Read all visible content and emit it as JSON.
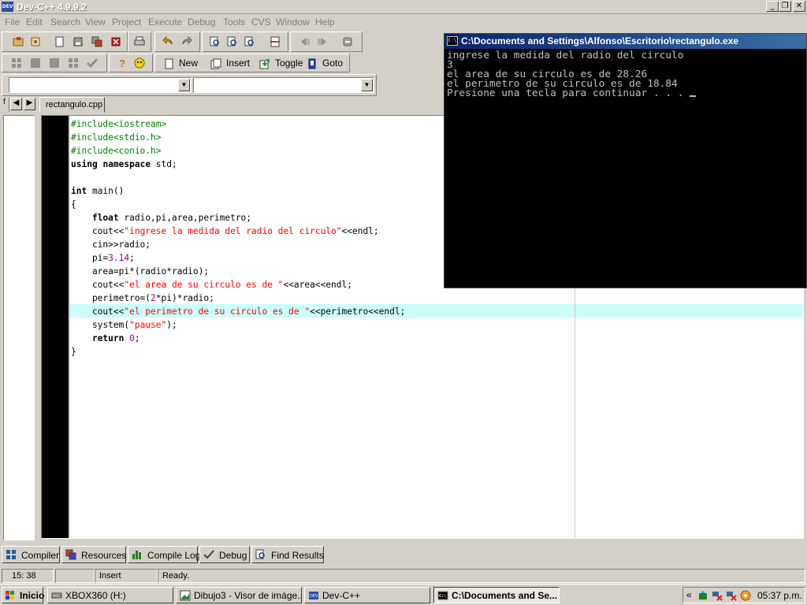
{
  "window": {
    "title": "Dev-C++ 4.9.9.2",
    "icon_label": "DEV"
  },
  "menu": [
    "File",
    "Edit",
    "Search",
    "View",
    "Project",
    "Execute",
    "Debug",
    "Tools",
    "CVS",
    "Window",
    "Help"
  ],
  "toolbar": {
    "new": "New",
    "insert": "Insert",
    "toggle": "Toggle",
    "goto": "Goto"
  },
  "editor": {
    "tab": "rectangulo.cpp",
    "lines": [
      [
        [
          "pp",
          "#include<iostream>"
        ]
      ],
      [
        [
          "pp",
          "#include<stdio.h>"
        ]
      ],
      [
        [
          "pp",
          "#include<conio.h>"
        ]
      ],
      [
        [
          "kw",
          "using"
        ],
        [
          "",
          " "
        ],
        [
          "kw",
          "namespace"
        ],
        [
          "",
          " std;"
        ]
      ],
      [],
      [
        [
          "kw",
          "int"
        ],
        [
          "",
          " main()"
        ]
      ],
      [
        [
          "",
          "{"
        ]
      ],
      [
        [
          "",
          "    "
        ],
        [
          "kw",
          "float"
        ],
        [
          "",
          " radio,pi,area,perimetro;"
        ]
      ],
      [
        [
          "",
          "    cout<<"
        ],
        [
          "str",
          "\"ingrese la medida del radio del circulo\""
        ],
        [
          "",
          "<<endl;"
        ]
      ],
      [
        [
          "",
          "    cin>>radio;"
        ]
      ],
      [
        [
          "",
          "    pi="
        ],
        [
          "num",
          "3.14"
        ],
        [
          "",
          ";"
        ]
      ],
      [
        [
          "",
          "    area=pi*(radio*radio);"
        ]
      ],
      [
        [
          "",
          "    cout<<"
        ],
        [
          "str",
          "\"el area de su circulo es de \""
        ],
        [
          "",
          "<<area<<endl;"
        ]
      ],
      [
        [
          "",
          "    perimetro=("
        ],
        [
          "num",
          "2"
        ],
        [
          "",
          "*pi)*radio;"
        ]
      ],
      [
        [
          "",
          "    cout<<"
        ],
        [
          "str",
          "\"el perimetro de su circulo es de \""
        ],
        [
          "",
          "<<perimetro<<endl;"
        ]
      ],
      [
        [
          "",
          "    system("
        ],
        [
          "str",
          "\"pause\""
        ],
        [
          "",
          ");"
        ]
      ],
      [
        [
          "",
          "    "
        ],
        [
          "kw",
          "return"
        ],
        [
          "",
          " "
        ],
        [
          "num",
          "0"
        ],
        [
          "",
          ";"
        ]
      ],
      [
        [
          "",
          "}"
        ]
      ]
    ],
    "highlighted_line": 15
  },
  "console": {
    "title": "C:\\Documents and Settings\\Alfonso\\Escritorio\\rectangulo.exe",
    "icon_label": "C:\\",
    "lines": [
      "ingrese la medida del radio del circulo",
      "3",
      "el area de su circulo es de 28.26",
      "el perimetro de su circulo es de 18.84",
      "Presione una tecla para continuar . . . "
    ]
  },
  "bottom_tabs": [
    "Compiler",
    "Resources",
    "Compile Log",
    "Debug",
    "Find Results"
  ],
  "status": {
    "position": "15: 38",
    "mode": "Insert",
    "message": "Ready."
  },
  "taskbar": {
    "start": "Inicio",
    "tasks": [
      "XBOX360 (H:)",
      "Dibujo3 - Visor de imáge...",
      "Dev-C++",
      "C:\\Documents and Se..."
    ],
    "active_task": 3,
    "tray_expand": "«",
    "clock": "05:37 p.m."
  }
}
